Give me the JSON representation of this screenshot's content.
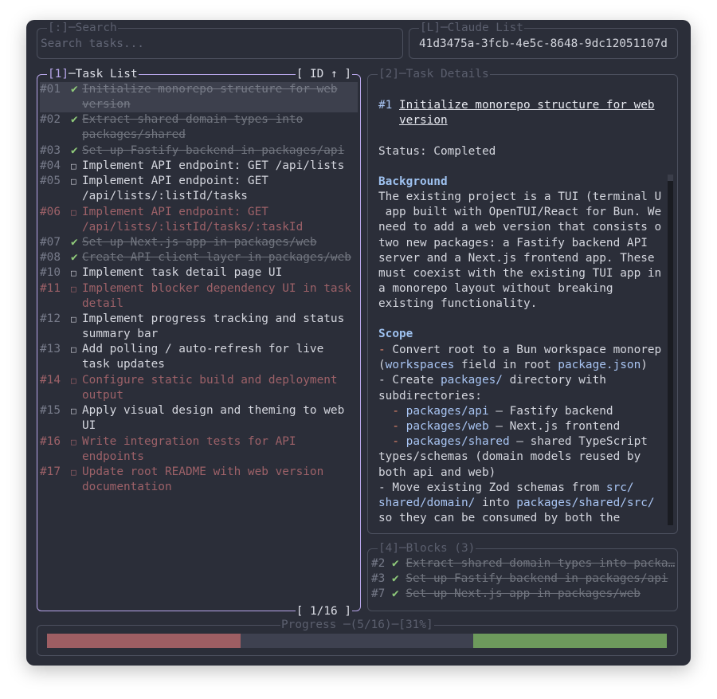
{
  "search": {
    "title_key": "[:]",
    "title_label": "─Search",
    "placeholder": "Search tasks..."
  },
  "claude_list": {
    "title_key": "[L]",
    "title_label": "─Claude List",
    "value": "41d3475a-3fcb-4e5c-8648-9dc12051107d"
  },
  "task_list": {
    "title_key": "[1]",
    "title_label": "─Task List",
    "sort_label": "[ ID ↑ ]",
    "pager": "[ 1/16 ]",
    "tasks": [
      {
        "id": "#01",
        "status": "done",
        "status_icon": "✔",
        "lines": [
          "Initialize monorepo structure for web",
          "version"
        ],
        "selected": true
      },
      {
        "id": "#02",
        "status": "done",
        "status_icon": "✔",
        "lines": [
          "Extract shared domain types into",
          "packages/shared"
        ]
      },
      {
        "id": "#03",
        "status": "done",
        "status_icon": "✔",
        "lines": [
          "Set up Fastify backend in packages/api"
        ]
      },
      {
        "id": "#04",
        "status": "pending",
        "status_icon": "□",
        "lines": [
          "Implement API endpoint: GET /api/lists"
        ]
      },
      {
        "id": "#05",
        "status": "pending",
        "status_icon": "□",
        "lines": [
          "Implement API endpoint: GET",
          "/api/lists/:listId/tasks"
        ]
      },
      {
        "id": "#06",
        "status": "blocked",
        "status_icon": "□",
        "lines": [
          "Implement API endpoint: GET",
          "/api/lists/:listId/tasks/:taskId"
        ]
      },
      {
        "id": "#07",
        "status": "done",
        "status_icon": "✔",
        "lines": [
          "Set up Next.js app in packages/web"
        ]
      },
      {
        "id": "#08",
        "status": "done",
        "status_icon": "✔",
        "lines": [
          "Create API client layer in packages/web"
        ]
      },
      {
        "id": "#10",
        "status": "pending",
        "status_icon": "□",
        "lines": [
          "Implement task detail page UI"
        ]
      },
      {
        "id": "#11",
        "status": "blocked",
        "status_icon": "□",
        "lines": [
          "Implement blocker dependency UI in task",
          "detail"
        ]
      },
      {
        "id": "#12",
        "status": "pending",
        "status_icon": "□",
        "lines": [
          "Implement progress tracking and status",
          "summary bar"
        ]
      },
      {
        "id": "#13",
        "status": "pending",
        "status_icon": "□",
        "lines": [
          "Add polling / auto-refresh for live",
          "task updates"
        ]
      },
      {
        "id": "#14",
        "status": "blocked",
        "status_icon": "□",
        "lines": [
          "Configure static build and deployment",
          "output"
        ]
      },
      {
        "id": "#15",
        "status": "pending",
        "status_icon": "□",
        "lines": [
          "Apply visual design and theming to web",
          "UI"
        ]
      },
      {
        "id": "#16",
        "status": "blocked",
        "status_icon": "□",
        "lines": [
          "Write integration tests for API",
          "endpoints"
        ]
      },
      {
        "id": "#17",
        "status": "blocked",
        "status_icon": "□",
        "lines": [
          "Update root README with web version",
          "documentation"
        ]
      }
    ]
  },
  "task_details": {
    "title_key": "[2]",
    "title_label": "─Task Details",
    "number": "#1",
    "title_line1": "Initialize monorepo structure for web",
    "title_line2": "version",
    "status": "Status: Completed",
    "background_heading": "Background",
    "background_lines": [
      "The existing project is a TUI (terminal U",
      " app built with OpenTUI/React for Bun. We",
      "need to add a web version that consists o",
      "two new packages: a Fastify backend API",
      "server and a Next.js frontend app. These",
      "must coexist with the existing TUI app in",
      "a monorepo layout without breaking",
      "existing functionality."
    ],
    "scope_heading": "Scope",
    "scope_lines": [
      [
        {
          "t": "- ",
          "c": "dash"
        },
        {
          "t": "Convert root to a Bun workspace monorep"
        }
      ],
      [
        {
          "t": "("
        },
        {
          "t": "workspaces",
          "c": "accent"
        },
        {
          "t": " field in root "
        },
        {
          "t": "package.json",
          "c": "accent"
        },
        {
          "t": ")"
        }
      ],
      [
        {
          "t": "- Create "
        },
        {
          "t": "packages/",
          "c": "accent"
        },
        {
          "t": " directory with"
        }
      ],
      [
        {
          "t": "subdirectories:"
        }
      ],
      [
        {
          "t": "  - ",
          "c": "dash"
        },
        {
          "t": "packages/api",
          "c": "accent"
        },
        {
          "t": " — Fastify backend"
        }
      ],
      [
        {
          "t": "  - ",
          "c": "dash"
        },
        {
          "t": "packages/web",
          "c": "accent"
        },
        {
          "t": " — Next.js frontend"
        }
      ],
      [
        {
          "t": "  - ",
          "c": "dash"
        },
        {
          "t": "packages/shared",
          "c": "accent"
        },
        {
          "t": " — shared TypeScript"
        }
      ],
      [
        {
          "t": "types/schemas (domain models reused by"
        }
      ],
      [
        {
          "t": "both api and web)"
        }
      ],
      [
        {
          "t": "- Move existing Zod schemas from "
        },
        {
          "t": "src/",
          "c": "accent"
        }
      ],
      [
        {
          "t": "shared/domain/",
          "c": "accent"
        },
        {
          "t": " into "
        },
        {
          "t": "packages/shared/src/",
          "c": "accent"
        }
      ],
      [
        {
          "t": "so they can be consumed by both the"
        }
      ]
    ]
  },
  "blocks": {
    "title_key": "[4]",
    "title_label": "─Blocks (3)",
    "items": [
      {
        "id": "#2",
        "status_icon": "✔",
        "title": "Extract shared domain types into packa…"
      },
      {
        "id": "#3",
        "status_icon": "✔",
        "title": "Set up Fastify backend in packages/api"
      },
      {
        "id": "#7",
        "status_icon": "✔",
        "title": "Set up Next.js app in packages/web"
      }
    ]
  },
  "progress": {
    "label": "Progress ─(5/16)─[31%]",
    "done": 5,
    "total": 16,
    "percent": 31,
    "segments": [
      {
        "status": "blocked",
        "fraction": 0.3125,
        "color": "#9e5e63"
      },
      {
        "status": "pending",
        "fraction": 0.375,
        "color": "#3e4150"
      },
      {
        "status": "done",
        "fraction": 0.3125,
        "color": "#6d9a5c"
      }
    ]
  },
  "colors": {
    "window_bg": "#2b2e39",
    "active_border": "#b9a7ec",
    "inactive_border": "#4c505e",
    "done_check": "#8fc97a",
    "blocked": "#9d6168",
    "link": "#a8c4f2",
    "heading": "#9ec1ef",
    "bullet": "#e0856b"
  }
}
